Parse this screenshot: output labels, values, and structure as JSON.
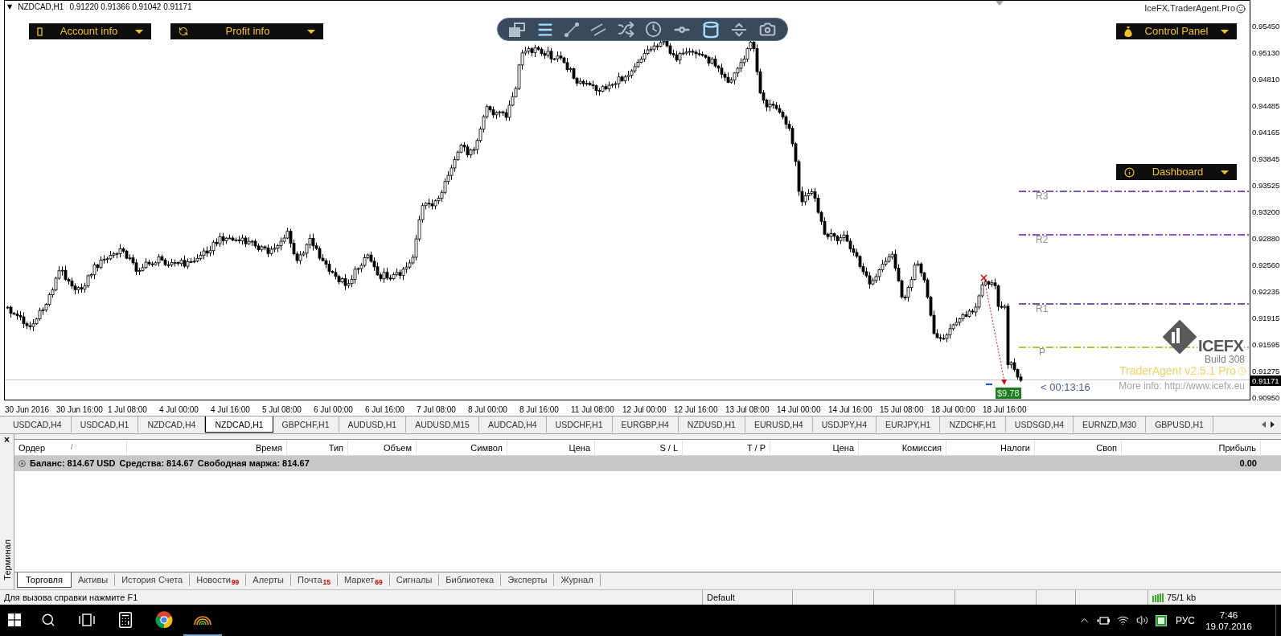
{
  "chart": {
    "collapse_marker": "▼",
    "symbol": "NZDCAD,H1",
    "ohlc": "0.91220 0.91366 0.91042 0.91171",
    "left_panels": [
      {
        "kind": "account",
        "label": "Account info"
      },
      {
        "kind": "profit",
        "label": "Profit info"
      }
    ],
    "toolbar": [
      {
        "kind": "windows",
        "active": false
      },
      {
        "kind": "lines",
        "active": true
      },
      {
        "kind": "trendline",
        "active": false
      },
      {
        "kind": "channel",
        "active": false
      },
      {
        "kind": "shuffle",
        "active": false
      },
      {
        "kind": "clock",
        "active": false
      },
      {
        "kind": "orbit",
        "active": false
      },
      {
        "kind": "cylinder",
        "active": true
      },
      {
        "kind": "split",
        "active": false
      },
      {
        "kind": "camera",
        "active": false
      }
    ],
    "brand": "IceFX.TraderAgent.Pro",
    "right_panels": [
      {
        "kind": "control",
        "label": "Control Panel"
      },
      {
        "kind": "dashboard",
        "label": "Dashboard"
      }
    ],
    "pivot_levels": [
      {
        "label": "R3",
        "color": "#7e57a8"
      },
      {
        "label": "R2",
        "color": "#9a4fc6"
      },
      {
        "label": "R1",
        "color": "#7e57a8"
      },
      {
        "label": "P",
        "color": "#b3c23c"
      }
    ],
    "logo": {
      "name": "ICEFX",
      "build": "Build 308",
      "version": "TraderAgent v2.5.1 Pro",
      "more_info": "More info: http://www.icefx.eu"
    },
    "countdown": "< 00:13:16",
    "profit_tag": "$9.78",
    "price_axis": [
      "0.95450",
      "0.95130",
      "0.94810",
      "0.94485",
      "0.94165",
      "0.93845",
      "0.93525",
      "0.93200",
      "0.92880",
      "0.92560",
      "0.92235",
      "0.91915",
      "0.91595",
      "0.91275",
      "0.90950"
    ],
    "current_price": "0.91171",
    "time_axis": [
      "30 Jun 2016",
      "30 Jun 16:00",
      "1 Jul 08:00",
      "4 Jul 00:00",
      "4 Jul 16:00",
      "5 Jul 08:00",
      "6 Jul 00:00",
      "6 Jul 16:00",
      "7 Jul 08:00",
      "8 Jul 00:00",
      "8 Jul 16:00",
      "11 Jul 08:00",
      "12 Jul 00:00",
      "12 Jul 16:00",
      "13 Jul 08:00",
      "14 Jul 00:00",
      "14 Jul 16:00",
      "15 Jul 08:00",
      "18 Jul 00:00",
      "18 Jul 16:00"
    ]
  },
  "chart_tabs": [
    {
      "label": "USDCAD,H4",
      "selected": false
    },
    {
      "label": "USDCAD,H1",
      "selected": false
    },
    {
      "label": "NZDCAD,H4",
      "selected": false
    },
    {
      "label": "NZDCAD,H1",
      "selected": true
    },
    {
      "label": "GBPCHF,H1",
      "selected": false
    },
    {
      "label": "AUDUSD,H1",
      "selected": false
    },
    {
      "label": "AUDUSD,M15",
      "selected": false
    },
    {
      "label": "AUDCAD,H4",
      "selected": false
    },
    {
      "label": "USDCHF,H1",
      "selected": false
    },
    {
      "label": "EURGBP,H4",
      "selected": false
    },
    {
      "label": "NZDUSD,H1",
      "selected": false
    },
    {
      "label": "EURUSD,H4",
      "selected": false
    },
    {
      "label": "USDJPY,H4",
      "selected": false
    },
    {
      "label": "EURJPY,H1",
      "selected": false
    },
    {
      "label": "NZDCHF,H1",
      "selected": false
    },
    {
      "label": "USDSGD,H4",
      "selected": false
    },
    {
      "label": "EURNZD,M30",
      "selected": false
    },
    {
      "label": "GBPUSD,H1",
      "selected": false
    }
  ],
  "terminal": {
    "close": "×",
    "title": "Терминал",
    "columns": [
      {
        "label": "Ордер",
        "sort_mark": "/"
      },
      {
        "label": "Время"
      },
      {
        "label": "Тип"
      },
      {
        "label": "Объем"
      },
      {
        "label": "Символ"
      },
      {
        "label": "Цена"
      },
      {
        "label": "S / L"
      },
      {
        "label": "T / P"
      },
      {
        "label": "Цена"
      },
      {
        "label": "Комиссия"
      },
      {
        "label": "Налоги"
      },
      {
        "label": "Своп"
      },
      {
        "label": "Прибыль"
      }
    ],
    "balance_row": {
      "items": [
        "Баланс: 814.67 USD",
        "Средства: 814.67",
        "Свободная маржа: 814.67"
      ],
      "profit": "0.00"
    },
    "tabs": [
      {
        "label": "Торговля",
        "selected": true
      },
      {
        "label": "Активы",
        "selected": false
      },
      {
        "label": "История Счета",
        "selected": false
      },
      {
        "label": "Новости",
        "badge": "99",
        "selected": false
      },
      {
        "label": "Алерты",
        "selected": false
      },
      {
        "label": "Почта",
        "badge": "15",
        "selected": false
      },
      {
        "label": "Маркет",
        "badge": "69",
        "selected": false
      },
      {
        "label": "Сигналы",
        "selected": false
      },
      {
        "label": "Библиотека",
        "selected": false
      },
      {
        "label": "Эксперты",
        "selected": false
      },
      {
        "label": "Журнал",
        "selected": false
      }
    ]
  },
  "status_bar": {
    "help": "Для вызова справки нажмите F1",
    "profile": "Default",
    "traffic": "75/1 kb"
  },
  "taskbar": {
    "buttons": [
      {
        "kind": "start",
        "running": false
      },
      {
        "kind": "search",
        "running": false
      },
      {
        "kind": "taskview",
        "running": false
      },
      {
        "kind": "calculator",
        "running": false
      },
      {
        "kind": "browser",
        "running": false
      },
      {
        "kind": "terminal",
        "running": true
      }
    ],
    "language": "РУС",
    "time": "7:46",
    "date": "19.07.2016"
  }
}
